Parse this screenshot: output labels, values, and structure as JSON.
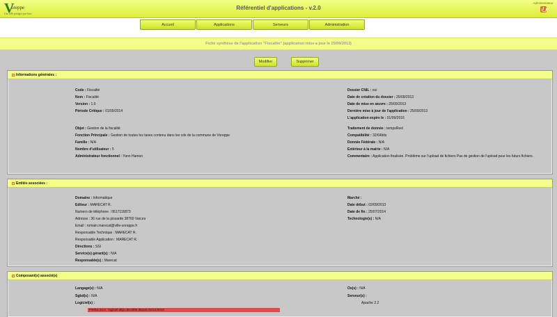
{
  "header": {
    "logo_letter": "V",
    "logo_text": "oreppe",
    "logo_tagline": "Une ville protégée par bien",
    "title": "Référentiel d'applications - v.2.0",
    "user_role": "Administrateur"
  },
  "nav": {
    "tabs": [
      "Accueil",
      "Applications",
      "Serveurs",
      "Administration"
    ]
  },
  "subtitle": "Fiche synthèse de l'application \"Fiscalité\" (application mise a jour le 25/09/2013)",
  "actions": {
    "modify": "Modifier",
    "delete": "Supprimer"
  },
  "general": {
    "heading": "Informations générales :",
    "left": [
      {
        "label": "Code :",
        "value": "Fiscalité"
      },
      {
        "label": "Nom :",
        "value": "Fiscalité"
      },
      {
        "label": "Version :",
        "value": "1.0"
      },
      {
        "label": "Période Critique :",
        "value": "01/09/2014"
      },
      {
        "label": "Objet :",
        "value": "Gestion de la fiscalité"
      },
      {
        "label": "Fonction Principale :",
        "value": "Gestion de toutes les taxes contenu dans les cds de la commune de Voreppe"
      },
      {
        "label": "Famille :",
        "value": "N/A"
      },
      {
        "label": "Nombre d'utilisateur :",
        "value": "5"
      },
      {
        "label": "Administrateur fonctionnel :",
        "value": "Yann Hamon"
      }
    ],
    "right": [
      {
        "label": "Dossier CNIL :",
        "value": "oui"
      },
      {
        "label": "Date de création du dossier :",
        "value": "25/09/2013"
      },
      {
        "label": "Date de mise en œuvre :",
        "value": "25/09/2013"
      },
      {
        "label": "Dernière mise à jour de l'application :",
        "value": "25/09/2013"
      },
      {
        "label": "L'application expire le :",
        "value": "01/09/2016"
      },
      {
        "label": "Traitement de donnée :",
        "value": "tempsReel"
      },
      {
        "label": "Compatibilité :",
        "value": "32/64bits"
      },
      {
        "label": "Donnée Fédérale :",
        "value": "N/A"
      },
      {
        "label": "Extérieur à la mairie :",
        "value": "N/A"
      },
      {
        "label": "Commentaire :",
        "value": "Application finalisée. Problème sur l'upload de fichiers Pas de gestion de l'upload pour les futurs fichiers."
      }
    ]
  },
  "entities": {
    "heading": "Entités associées :",
    "left": [
      {
        "label": "Domaine :",
        "value": "Informatique",
        "bold": true
      },
      {
        "label": "Editeur :",
        "value": "MARECAT R.",
        "bold": true
      },
      {
        "label": "Numero de téléphone :",
        "value": "0617116873",
        "bold": false
      },
      {
        "label": "Adresse :",
        "value": "36 rue de la pissarde 38760 Varces",
        "bold": false
      },
      {
        "label": "Email :",
        "value": "romain.marecat@ville-voreppe.fr",
        "bold": false
      },
      {
        "label": "Responsable Technique :",
        "value": "MARECAT R.",
        "bold": false
      },
      {
        "label": "Responsable Application :",
        "value": "MARECAT R.",
        "bold": false
      },
      {
        "label": "Directions :",
        "value": "SSI",
        "bold": true
      },
      {
        "label": "Service(s) gérant(s) :",
        "value": "N/A",
        "bold": true
      },
      {
        "label": "Responsable(s) :",
        "value": "Marecat",
        "bold": true
      }
    ],
    "right": [
      {
        "label": "Marché :",
        "value": ""
      },
      {
        "label": "Date début :",
        "value": "02/09/2013"
      },
      {
        "label": "Date de fin :",
        "value": "25/07/2014"
      },
      {
        "label": "Technologie(s) :",
        "value": "N/A"
      }
    ]
  },
  "components": {
    "heading": "Composant(s) associé(s)",
    "left": [
      {
        "label": "Langage(s) :",
        "value": "N/A"
      },
      {
        "label": "Sgbd(s) :",
        "value": "N/A"
      },
      {
        "label": "Logiciel(s) :",
        "value": ""
      }
    ],
    "right": [
      {
        "label": "Os(s) :",
        "value": "N/A"
      },
      {
        "label": "Serveur(s) :",
        "value": ""
      }
    ],
    "server_item": "Apache 2.2",
    "software_error": "Firefox 24.0 : logiciel déja obsolète depuis 02/12/2013",
    "error_color": "#e84848"
  },
  "colors": {
    "accent": "#dcef3a",
    "band": "#f4ff8a",
    "background": "#c8c8c8"
  }
}
